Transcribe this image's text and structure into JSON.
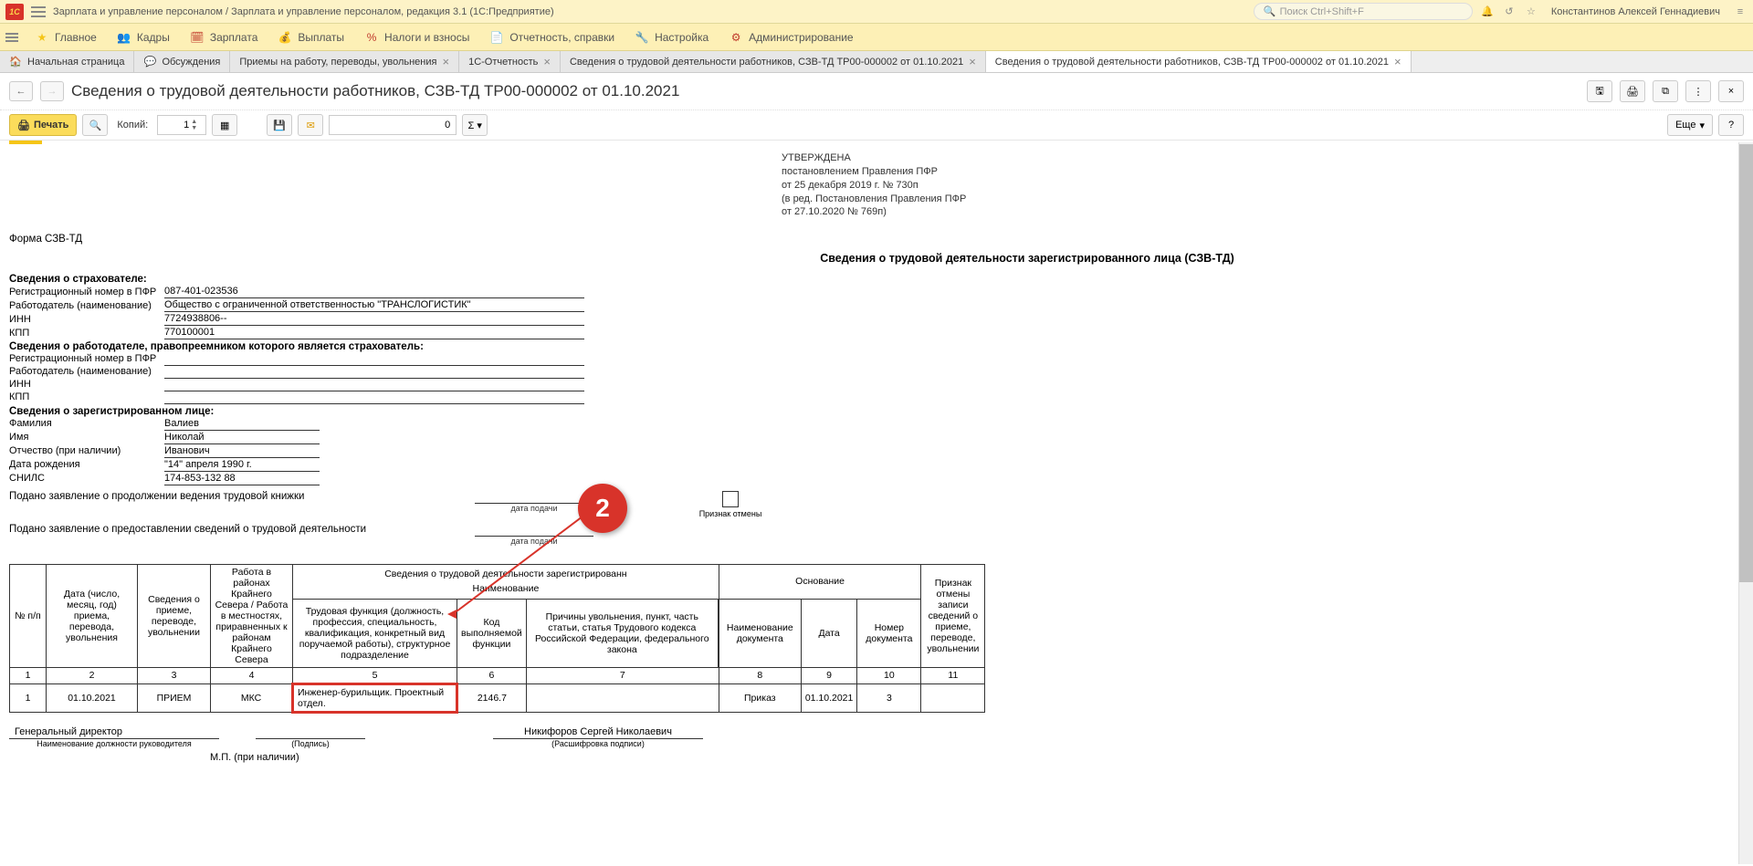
{
  "titlebar": {
    "title": "Зарплата и управление персоналом / Зарплата и управление персоналом, редакция 3.1  (1С:Предприятие)",
    "search_placeholder": "Поиск Ctrl+Shift+F",
    "user": "Константинов Алексей Геннадиевич"
  },
  "mainmenu": {
    "home": "Главное",
    "kadry": "Кадры",
    "zarplata": "Зарплата",
    "vyplaty": "Выплаты",
    "nalogi": "Налоги и взносы",
    "otchet": "Отчетность, справки",
    "nastroika": "Настройка",
    "admin": "Администрирование"
  },
  "tabs": {
    "home": "Начальная страница",
    "discuss": "Обсуждения",
    "t1": "Приемы на работу, переводы, увольнения",
    "t2": "1С-Отчетность",
    "t3": "Сведения о трудовой деятельности работников, СЗВ-ТД ТР00-000002 от 01.10.2021",
    "t4": "Сведения о трудовой деятельности работников, СЗВ-ТД ТР00-000002 от 01.10.2021"
  },
  "page": {
    "title": "Сведения о трудовой деятельности работников, СЗВ-ТД ТР00-000002 от 01.10.2021"
  },
  "toolbar": {
    "print": "Печать",
    "copies_label": "Копий:",
    "copies_value": "1",
    "num_value": "0",
    "more": "Еще",
    "help": "?"
  },
  "doc": {
    "approved_l1": "УТВЕРЖДЕНА",
    "approved_l2": "постановлением Правления ПФР",
    "approved_l3": "от 25 декабря 2019 г. № 730п",
    "approved_l4": "(в ред. Постановления Правления ПФР",
    "approved_l5": "от 27.10.2020 № 769п)",
    "form_name": "Форма СЗВ-ТД",
    "title": "Сведения о трудовой деятельности зарегистрированного лица (СЗВ-ТД)",
    "s_ins": "Сведения о страхователе:",
    "reg_lbl": "Регистрационный номер в ПФР",
    "reg_val": "087-401-023536",
    "emp_lbl": "Работодатель (наименование)",
    "emp_val": "Общество с ограниченной ответственностью \"ТРАНСЛОГИСТИК\"",
    "inn_lbl": "ИНН",
    "inn_val": "7724938806--",
    "kpp_lbl": "КПП",
    "kpp_val": "770100001",
    "s_pred": "Сведения о работодателе, правопреемником которого является страхователь:",
    "pred_reg_val": "",
    "pred_emp_val": "",
    "pred_inn_val": "",
    "pred_kpp_val": "",
    "s_pers": "Сведения о зарегистрированном лице:",
    "fam_lbl": "Фамилия",
    "fam_val": "Валиев",
    "name_lbl": "Имя",
    "name_val": "Николай",
    "otch_lbl": "Отчество (при наличии)",
    "otch_val": "Иванович",
    "birth_lbl": "Дата рождения",
    "birth_val": "\"14\" апреля 1990 г.",
    "snils_lbl": "СНИЛС",
    "snils_val": "174-853-132 88",
    "stmt1": "Подано заявление о продолжении ведения трудовой книжки",
    "stmt2": "Подано заявление о предоставлении сведений о трудовой деятельности",
    "date_cap": "дата подачи",
    "cancel_cap": "Признак отмены",
    "table_title": "Сведения о трудовой деятельности зарегистрированн",
    "th_naim": "Наименование",
    "th_osn": "Основание",
    "th_npp": "№ п/п",
    "th_date": "Дата (число, месяц, год) приема, перевода, увольнения",
    "th_sved": "Сведения о приеме, переводе, увольнении",
    "th_sever": "Работа в районах Крайнего Севера / Работа в местностях, приравненных к районам Крайнего Севера",
    "th_func": "Трудовая функция (должность, профессия, специальность, квалификация, конкретный вид поручаемой работы), структурное подразделение",
    "th_kod": "Код выполняемой функции",
    "th_prich": "Причины увольнения, пункт, часть статьи, статья Трудового кодекса Российской Федерации, федерального закона",
    "th_naimdoc": "Наименование документа",
    "th_dataosn": "Дата",
    "th_nomdoc": "Номер документа",
    "th_priznak": "Признак отмены записи сведений о приеме, переводе, увольнении",
    "row": {
      "c1": "1",
      "c2": "01.10.2021",
      "c3": "ПРИЕМ",
      "c4": "МКС",
      "c5": "Инженер-бурильщик. Проектный отдел.",
      "c6": "2146.7",
      "c7": "",
      "c8": "Приказ",
      "c9": "01.10.2021",
      "c10": "3",
      "c11": ""
    },
    "sign_dir": "Генеральный директор",
    "sign_dir_cap": "Наименование должности руководителя",
    "sign_sig_cap": "(Подпись)",
    "sign_name": "Никифоров Сергей Николаевич",
    "sign_name_cap": "(Расшифровка подписи)",
    "mp": "М.П. (при наличии)"
  },
  "callout": {
    "num": "2"
  }
}
